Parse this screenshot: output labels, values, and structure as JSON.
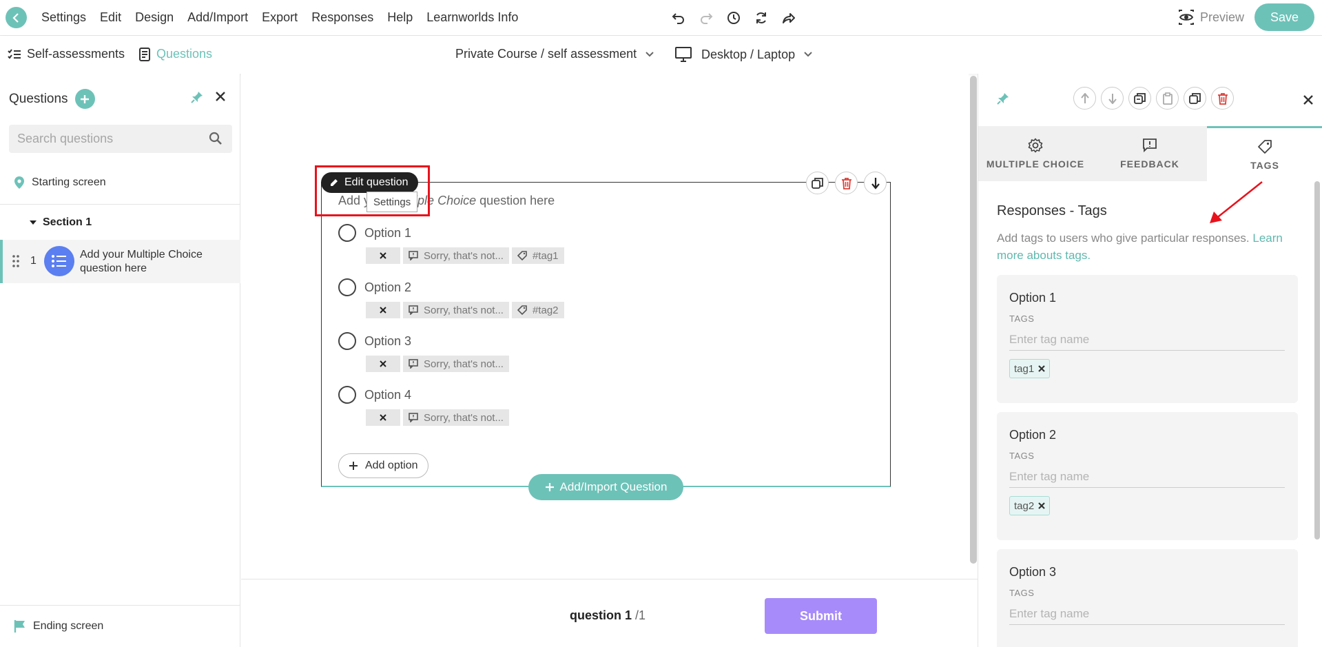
{
  "topbar": {
    "menu": [
      "Settings",
      "Edit",
      "Design",
      "Add/Import",
      "Export",
      "Responses",
      "Help",
      "Learnworlds Info"
    ],
    "preview_label": "Preview",
    "save_label": "Save"
  },
  "subbar": {
    "self_assessments": "Self-assessments",
    "questions": "Questions",
    "course": "Private Course / self assessment",
    "device": "Desktop / Laptop"
  },
  "left_panel": {
    "title": "Questions",
    "search_placeholder": "Search questions",
    "starting_screen": "Starting screen",
    "section": "Section 1",
    "question": {
      "number": "1",
      "text": "Add your Multiple Choice question here"
    },
    "ending_screen": "Ending screen"
  },
  "question_card": {
    "edit_label": "Edit question",
    "tooltip": "Settings",
    "title_prefix": "Add your ",
    "title_italic": "Multiple Choice",
    "title_suffix": " question here",
    "options": [
      {
        "label": "Option 1",
        "feedback": "Sorry, that's not...",
        "tag": "#tag1"
      },
      {
        "label": "Option 2",
        "feedback": "Sorry, that's not...",
        "tag": "#tag2"
      },
      {
        "label": "Option 3",
        "feedback": "Sorry, that's not...",
        "tag": ""
      },
      {
        "label": "Option 4",
        "feedback": "Sorry, that's not...",
        "tag": ""
      }
    ],
    "add_option": "Add option",
    "add_import": "Add/Import Question"
  },
  "footer": {
    "question_label": "question 1",
    "total": "/1",
    "submit": "Submit"
  },
  "right_panel": {
    "tabs": [
      "MULTIPLE CHOICE",
      "FEEDBACK",
      "TAGS"
    ],
    "active_tab": "TAGS",
    "title": "Responses - Tags",
    "description": "Add tags to users who give particular responses.",
    "link": "Learn more abouts tags.",
    "tags_label": "TAGS",
    "tag_placeholder": "Enter tag name",
    "cards": [
      {
        "option": "Option 1",
        "tag": "tag1"
      },
      {
        "option": "Option 2",
        "tag": "tag2"
      },
      {
        "option": "Option 3",
        "tag": ""
      }
    ]
  },
  "colors": {
    "accent": "#6dc2b8",
    "submit": "#a78bfa",
    "question_icon": "#5b7ff0",
    "highlight": "#e8121c"
  }
}
